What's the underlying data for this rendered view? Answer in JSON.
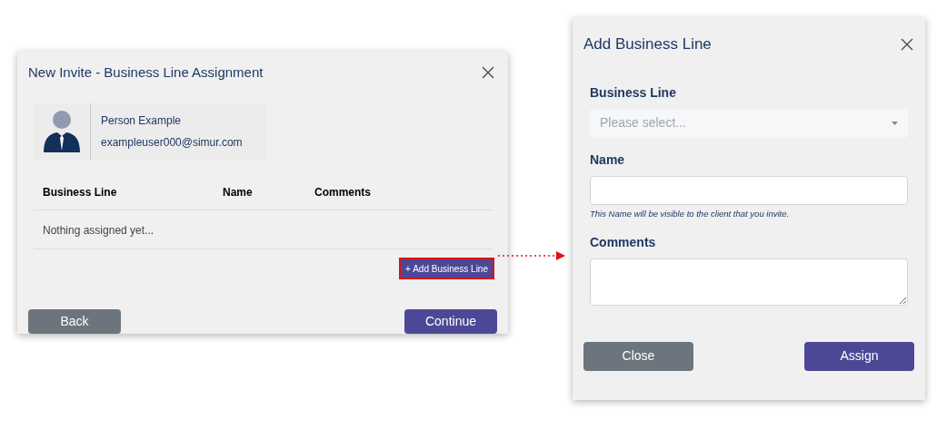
{
  "invite_dialog": {
    "title": "New Invite - Business Line Assignment",
    "person": {
      "name": "Person Example",
      "email": "exampleuser000@simur.com"
    },
    "table": {
      "columns": [
        "Business Line",
        "Name",
        "Comments"
      ],
      "empty_text": "Nothing assigned yet..."
    },
    "add_button": {
      "label": "+ Add Business Line",
      "highlighted": true
    },
    "buttons": [
      {
        "label": "Back",
        "kind": "secondary"
      },
      {
        "label": "Continue",
        "kind": "primary"
      }
    ]
  },
  "add_dialog": {
    "title": "Add Business Line",
    "fields": [
      {
        "label": "Business Line",
        "kind": "select",
        "placeholder": "Please select..."
      },
      {
        "label": "Name",
        "kind": "text",
        "hint": "This Name will be visible to the client that you invite."
      },
      {
        "label": "Comments",
        "kind": "textarea"
      }
    ],
    "buttons": [
      {
        "label": "Close",
        "kind": "secondary"
      },
      {
        "label": "Assign",
        "kind": "primary"
      }
    ]
  }
}
